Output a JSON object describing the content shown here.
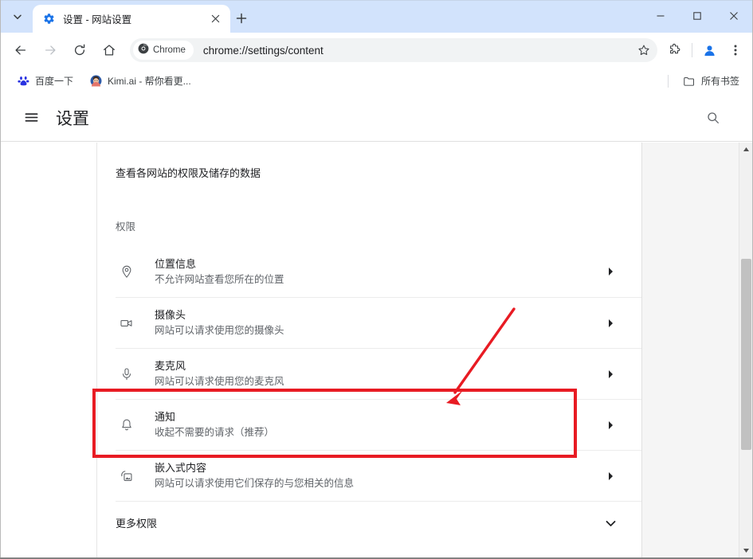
{
  "browser": {
    "tab": {
      "title": "设置 - 网站设置",
      "favicon": "gear-icon",
      "close_label": "×"
    },
    "tab_search_icon": "chevron-down-icon",
    "new_tab_label": "+",
    "window_controls": {
      "minimize": "—",
      "maximize": "□",
      "close": "✕"
    },
    "toolbar": {
      "back_icon": "back-arrow-icon",
      "forward_icon": "forward-arrow-icon",
      "reload_icon": "reload-icon",
      "home_icon": "home-icon",
      "chrome_chip_label": "Chrome",
      "url": "chrome://settings/content",
      "bookmark_star_icon": "star-icon",
      "extensions_icon": "extensions-puzzle-icon",
      "profile_icon": "profile-avatar-icon",
      "menu_icon": "three-dot-menu-icon"
    },
    "bookmarks": [
      {
        "label": "百度一下",
        "icon": "baidu-paw-favicon"
      },
      {
        "label": "Kimi.ai - 帮你看更...",
        "icon": "kimi-avatar-favicon"
      }
    ],
    "bookmarks_all": {
      "label": "所有书签",
      "icon": "folder-icon"
    }
  },
  "settings": {
    "menu_icon": "hamburger-menu-icon",
    "title": "设置",
    "search_icon": "search-icon",
    "intro": "查看各网站的权限及储存的数据",
    "section_label": "权限",
    "rows": [
      {
        "icon": "location-pin-icon",
        "title": "位置信息",
        "subtitle": "不允许网站查看您所在的位置",
        "arrow": "chevron-right-icon"
      },
      {
        "icon": "camera-icon",
        "title": "摄像头",
        "subtitle": "网站可以请求使用您的摄像头",
        "arrow": "chevron-right-icon"
      },
      {
        "icon": "microphone-icon",
        "title": "麦克风",
        "subtitle": "网站可以请求使用您的麦克风",
        "arrow": "chevron-right-icon"
      },
      {
        "icon": "bell-icon",
        "title": "通知",
        "subtitle": "收起不需要的请求（推荐）",
        "arrow": "chevron-right-icon"
      },
      {
        "icon": "embedded-content-icon",
        "title": "嵌入式内容",
        "subtitle": "网站可以请求使用它们保存的与您相关的信息",
        "arrow": "chevron-right-icon"
      }
    ],
    "more_permissions": {
      "title": "更多权限",
      "arrow": "chevron-down-icon"
    }
  },
  "annotation": {
    "highlight_color": "#e81b23",
    "arrow_color": "#e81b23",
    "target_row": "通知"
  },
  "colors": {
    "tabstrip_bg": "#d2e3fc",
    "omnibox_bg": "#f1f3f4",
    "accent_blue": "#1a73e8",
    "text_primary": "#202124",
    "text_secondary": "#5f6368"
  }
}
